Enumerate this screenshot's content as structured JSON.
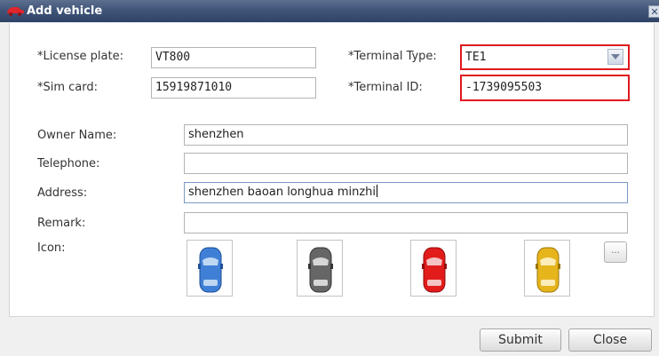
{
  "window": {
    "title": "Add vehicle",
    "close_glyph": "✕"
  },
  "form": {
    "license_plate": {
      "label": "*License plate:",
      "value": "VT800"
    },
    "terminal_type": {
      "label": "*Terminal Type:",
      "value": "TE1"
    },
    "sim_card": {
      "label": "*Sim card:",
      "value": "15919871010"
    },
    "terminal_id": {
      "label": "*Terminal ID:",
      "value": "-1739095503"
    },
    "owner_name": {
      "label": "Owner Name:",
      "value": "shenzhen"
    },
    "telephone": {
      "label": "Telephone:",
      "value": ""
    },
    "address": {
      "label": "Address:",
      "value": "shenzhen baoan longhua minzhi"
    },
    "remark": {
      "label": "Remark:",
      "value": ""
    },
    "icon": {
      "label": "Icon:",
      "options": [
        {
          "name": "blue-car-icon",
          "color": "#3f7fd6"
        },
        {
          "name": "gray-car-icon",
          "color": "#666666"
        },
        {
          "name": "red-car-icon",
          "color": "#e21b1b"
        },
        {
          "name": "yellow-car-icon",
          "color": "#e6b51c"
        }
      ],
      "more_label": "..."
    }
  },
  "buttons": {
    "submit": "Submit",
    "close": "Close"
  },
  "colors": {
    "highlight_border": "#e0191f",
    "title_bar": "#41557a"
  }
}
